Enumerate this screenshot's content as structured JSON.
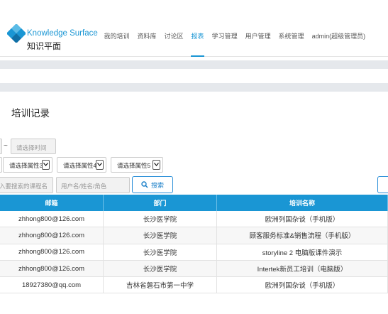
{
  "brand": {
    "name_en": "Knowledge Surface",
    "name_cn": "知识平面",
    "logo_icon": "diamond-logo-icon",
    "accent_color": "#1a96d4"
  },
  "nav": {
    "items": [
      {
        "label": "我的培训"
      },
      {
        "label": "资料库"
      },
      {
        "label": "讨论区"
      },
      {
        "label": "报表",
        "active": true
      },
      {
        "label": "学习管理"
      },
      {
        "label": "用户管理"
      },
      {
        "label": "系统管理"
      },
      {
        "label": "admin(超级管理员)"
      }
    ]
  },
  "page": {
    "title": "培训记录"
  },
  "filters": {
    "date_separator": "~",
    "end_date_placeholder": "请选择时间",
    "attribute_selects": [
      {
        "value": "请选择属性3"
      },
      {
        "value": "请选择属性4"
      },
      {
        "value": "请选择属性5"
      }
    ],
    "course_placeholder": "入要搜索的课程名",
    "user_placeholder": "用户名/姓名/角色",
    "search_label": "搜索",
    "search_icon": "search-icon",
    "select_icon": "chevron-down-icon"
  },
  "table": {
    "columns": [
      "邮箱",
      "部门",
      "培训名称"
    ],
    "rows": [
      [
        "zhhong800@126.com",
        "长沙医学院",
        "欧洲列国杂谈（手机版）"
      ],
      [
        "zhhong800@126.com",
        "长沙医学院",
        "顾客服务标准&销售流程（手机版）"
      ],
      [
        "zhhong800@126.com",
        "长沙医学院",
        "storyline 2 电脑版课件演示"
      ],
      [
        "zhhong800@126.com",
        "长沙医学院",
        "Intertek新员工培训（电脑版）"
      ],
      [
        "18927380@qq.com",
        "吉林省磐石市第一中学",
        "欧洲列国杂谈（手机版）"
      ]
    ],
    "header_color": "#1a96d4"
  }
}
